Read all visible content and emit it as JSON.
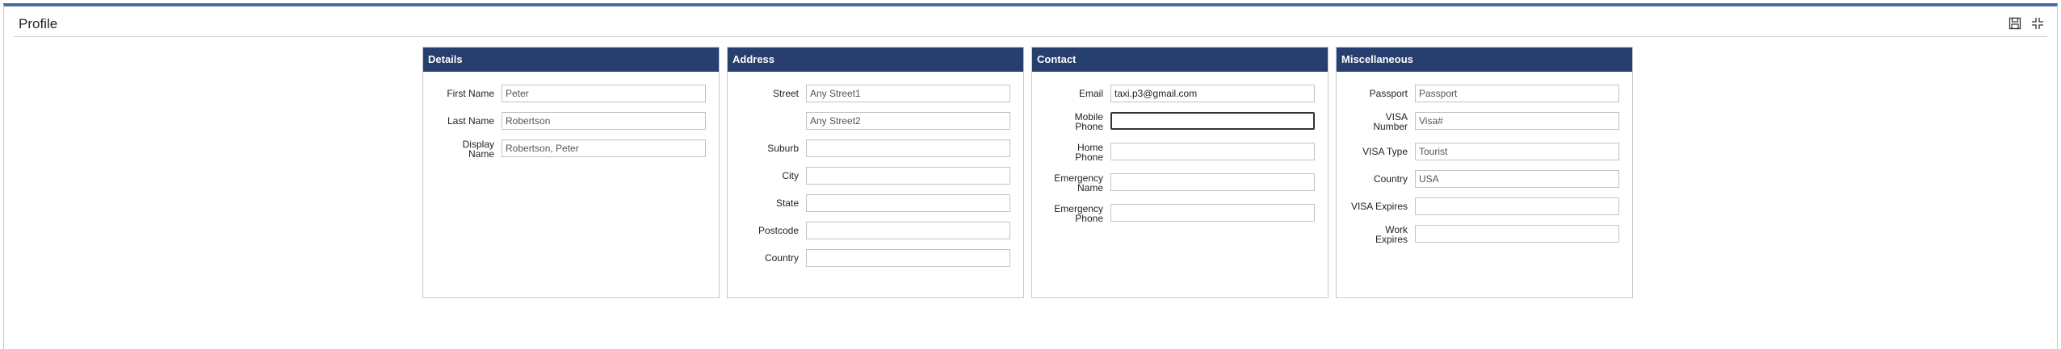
{
  "header": {
    "title": "Profile"
  },
  "icons": {
    "save": "save-icon",
    "collapse": "collapse-icon"
  },
  "details": {
    "title": "Details",
    "fields": [
      {
        "label": "First Name",
        "value": "Peter"
      },
      {
        "label": "Last Name",
        "value": "Robertson"
      },
      {
        "label": "Display Name",
        "value": "Robertson, Peter"
      }
    ]
  },
  "address": {
    "title": "Address",
    "fields": [
      {
        "label": "Street",
        "value": "Any Street1"
      },
      {
        "label": "",
        "value": "Any Street2"
      },
      {
        "label": "Suburb",
        "value": ""
      },
      {
        "label": "City",
        "value": ""
      },
      {
        "label": "State",
        "value": ""
      },
      {
        "label": "Postcode",
        "value": ""
      },
      {
        "label": "Country",
        "value": ""
      }
    ]
  },
  "contact": {
    "title": "Contact",
    "fields": [
      {
        "label": "Email",
        "value": "taxi.p3@gmail.com"
      },
      {
        "label": "Mobile Phone",
        "value": ""
      },
      {
        "label": "Home Phone",
        "value": ""
      },
      {
        "label": "Emergency Name",
        "value": ""
      },
      {
        "label": "Emergency Phone",
        "value": ""
      }
    ]
  },
  "misc": {
    "title": "Miscellaneous",
    "fields": [
      {
        "label": "Passport",
        "value": "Passport"
      },
      {
        "label": "VISA Number",
        "value": "Visa#"
      },
      {
        "label": "VISA Type",
        "value": "Tourist"
      },
      {
        "label": "Country",
        "value": "USA"
      },
      {
        "label": "VISA Expires",
        "value": ""
      },
      {
        "label": "Work Expires",
        "value": ""
      }
    ]
  }
}
